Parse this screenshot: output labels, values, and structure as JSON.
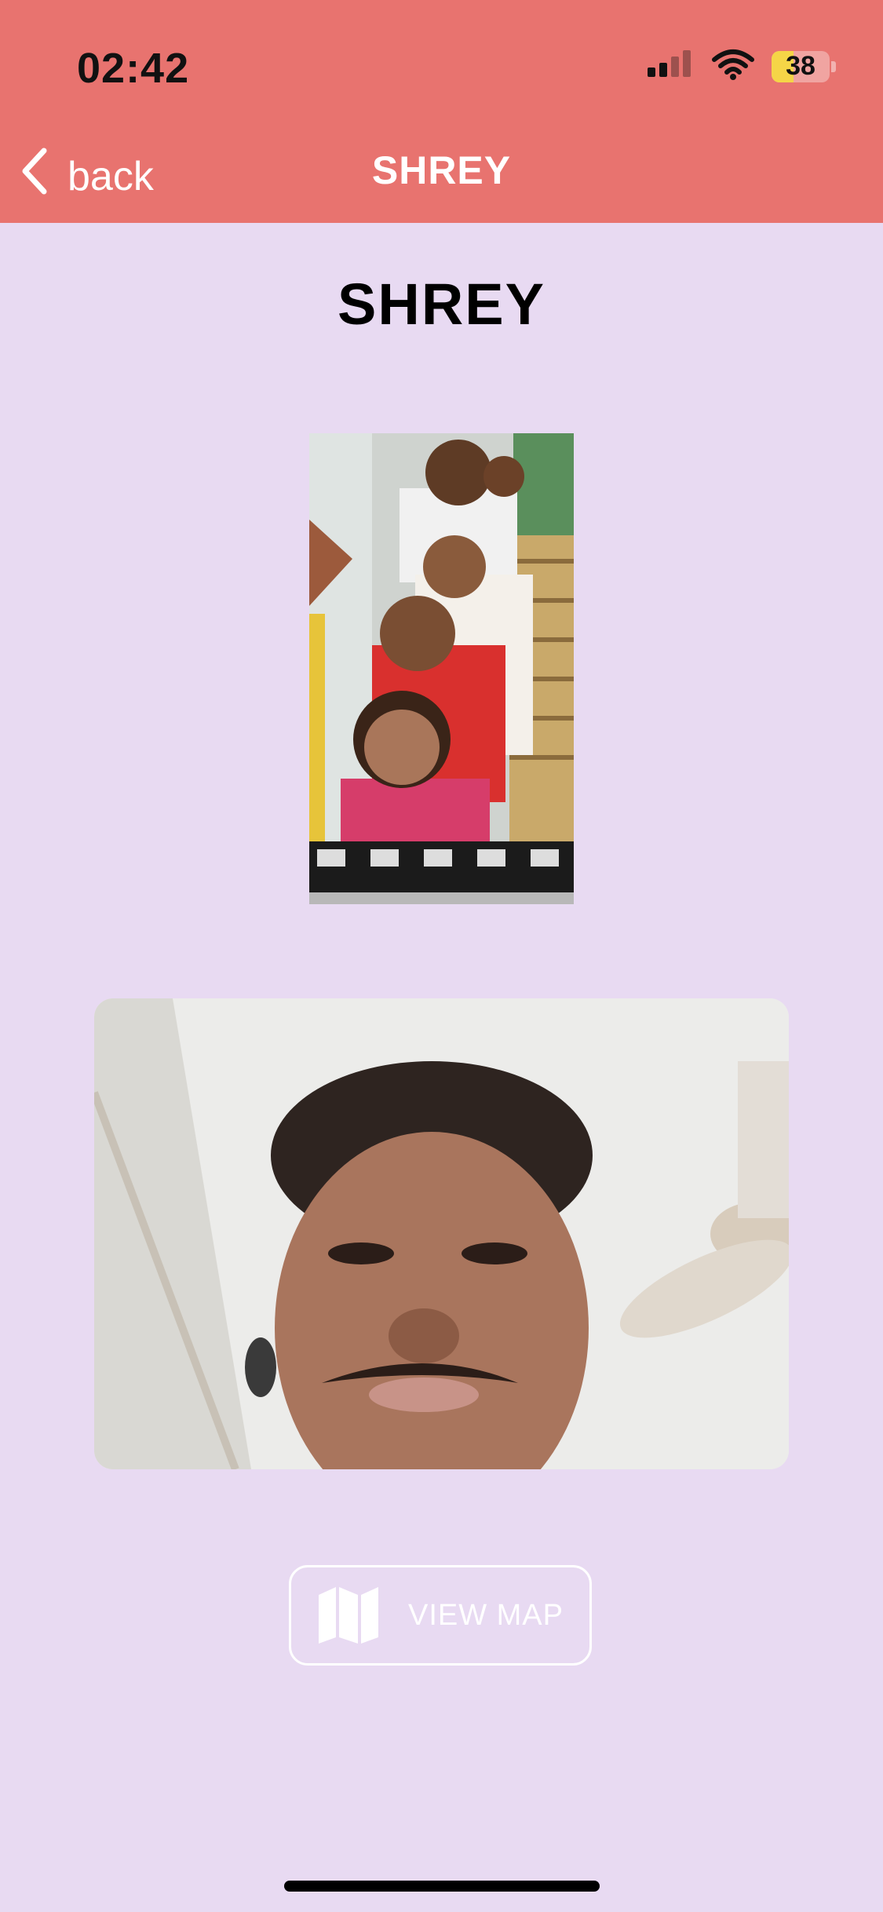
{
  "status_bar": {
    "time": "02:42",
    "battery_percent": "38",
    "battery_level": 0.38,
    "signal_icon": "cellular-signal-icon",
    "wifi_icon": "wifi-icon"
  },
  "nav": {
    "back_label": "back",
    "title": "SHREY"
  },
  "page": {
    "title": "SHREY"
  },
  "images": {
    "group_photo": "group-photo",
    "selfie_photo": "selfie-photo"
  },
  "actions": {
    "view_map_label": "VIEW MAP",
    "map_icon": "map-icon"
  },
  "colors": {
    "header": "#E8736F",
    "background": "#E8DAF2",
    "battery": "#F5D547"
  }
}
